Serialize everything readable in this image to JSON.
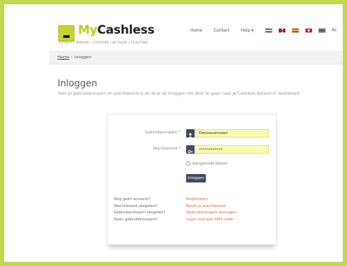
{
  "brand": {
    "name_my": "My",
    "name_rest": "Cashless",
    "tagline": "LOYALTY | SPAREN | COUPONS | BETALEN | TICKETING"
  },
  "nav": {
    "home": "Home",
    "contact": "Contact",
    "help": "Help ▾",
    "account": "Ac"
  },
  "breadcrumb": {
    "home": "Home",
    "separator": "»",
    "current": "Inloggen"
  },
  "page": {
    "title": "Inloggen",
    "intro": "Voer je gebruikersnaam en wachtwoord in en druk op Inloggen om door te gaan naar je Cashless Betalen® dashboard."
  },
  "form": {
    "username_label": "Gebruikersnaam *",
    "username_value": "Densevanveen",
    "password_label": "Wachtwoord *",
    "password_value": "••••••••••••",
    "remember_label": "Aangemeld blijven",
    "submit_label": "Inloggen"
  },
  "help_links": [
    {
      "question": "Nog geen account?",
      "link": "Registreren"
    },
    {
      "question": "Wachtwoord vergeten?",
      "link": "Reset je wachtwoord"
    },
    {
      "question": "Gebruikersnaam vergeten?",
      "link": "Gebruikersnaam opvragen"
    },
    {
      "question": "Geen gebruikersnaam?",
      "link": "Login met een SMS-code"
    }
  ],
  "colors": {
    "frame": "#c3d84f",
    "brand_accent": "#b7cc1c",
    "addon": "#3e4c5e",
    "link": "#d36b3c",
    "input_bg": "#fbfbb0"
  },
  "icons": {
    "username_addon": "user-icon",
    "password_addon": "key-icon",
    "flags": [
      "flag-nl",
      "flag-en",
      "flag-es",
      "flag-tr",
      "flag-th"
    ]
  }
}
